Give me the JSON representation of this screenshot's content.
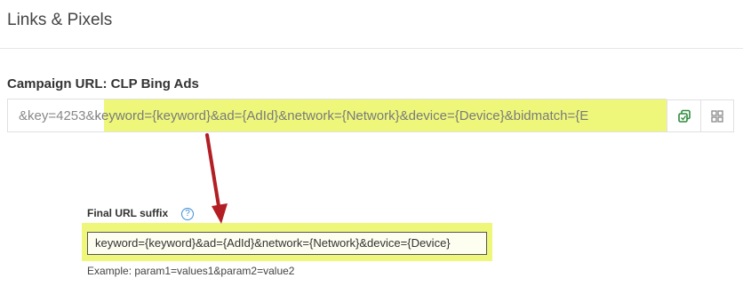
{
  "section": {
    "title": "Links & Pixels"
  },
  "campaign": {
    "label": "Campaign URL: CLP Bing Ads",
    "url_prefix": "&key=4253&",
    "url_highlighted": "keyword={keyword}&ad={AdId}&network={Network}&device={Device}&bidmatch={E"
  },
  "buttons": {
    "copy_icon": "copy-icon",
    "qr_icon": "qr-code-icon"
  },
  "suffix": {
    "label": "Final URL suffix",
    "help_glyph": "?",
    "value": "keyword={keyword}&ad={AdId}&network={Network}&device={Device}",
    "example": "Example: param1=values1&param2=value2"
  },
  "colors": {
    "highlight": "#eef77a",
    "arrow": "#b21e24",
    "copy_icon": "#2e8b3d"
  }
}
